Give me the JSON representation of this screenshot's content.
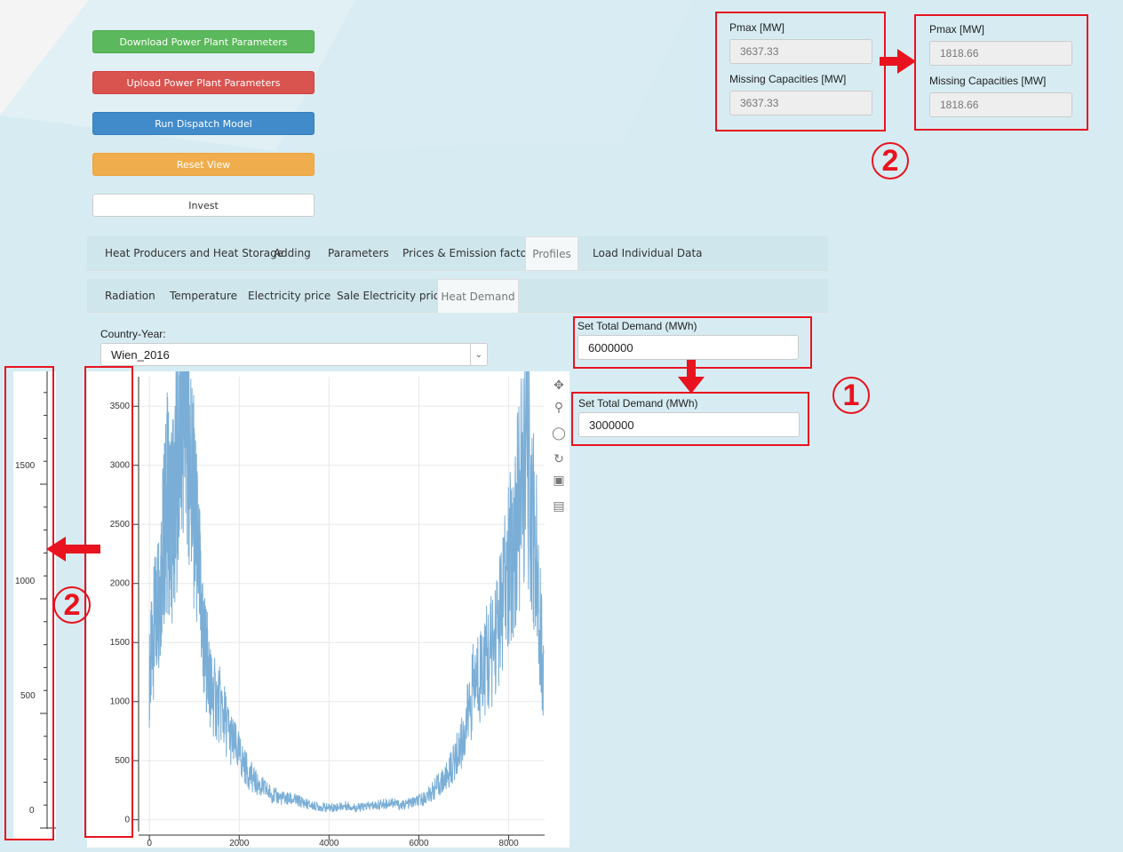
{
  "buttons": {
    "download": "Download Power Plant Parameters",
    "upload": "Upload Power Plant Parameters",
    "run": "Run Dispatch Model",
    "reset": "Reset View",
    "invest": "Invest"
  },
  "tabs_main": [
    "Heat Producers and Heat Storage",
    "Adding",
    "Parameters",
    "Prices & Emission factors",
    "Profiles",
    "Load Individual Data"
  ],
  "tabs_main_active": "Profiles",
  "tabs_sub": [
    "Radiation",
    "Temperature",
    "Electricity price",
    "Sale Electricity price",
    "Heat Demand"
  ],
  "tabs_sub_active": "Heat Demand",
  "country_year": {
    "label": "Country-Year:",
    "value": "Wien_2016"
  },
  "demand_before": {
    "label": "Set Total Demand (MWh)",
    "value": "6000000"
  },
  "demand_after": {
    "label": "Set Total Demand (MWh)",
    "value": "3000000"
  },
  "capacity_before": {
    "pmax_label": "Pmax [MW]",
    "pmax_value": "3637.33",
    "missing_label": "Missing Capacities [MW]",
    "missing_value": "3637.33"
  },
  "capacity_after": {
    "pmax_label": "Pmax [MW]",
    "pmax_value": "1818.66",
    "missing_label": "Missing Capacities [MW]",
    "missing_value": "1818.66"
  },
  "annotations": {
    "step1": "1",
    "step2_top": "2",
    "step2_left": "2"
  },
  "mini_axis": {
    "ticks": [
      "1500",
      "1000",
      "500",
      "0"
    ]
  },
  "chart_data": {
    "type": "line",
    "title": "",
    "xlabel": "",
    "ylabel": "",
    "xlim": [
      -200,
      8800
    ],
    "ylim": [
      -100,
      3750
    ],
    "xticks": [
      0,
      2000,
      4000,
      6000,
      8000
    ],
    "yticks": [
      0,
      500,
      1000,
      1500,
      2000,
      2500,
      3000,
      3500
    ],
    "grid": true,
    "color": "#7aaed6",
    "series": [
      {
        "x": [
          0,
          100,
          200,
          300,
          400,
          500,
          600,
          700,
          800,
          900,
          1000,
          1100,
          1200,
          1300,
          1400,
          1600,
          1800,
          2000,
          2200,
          2400,
          2600,
          2800,
          3000,
          3200,
          3400,
          3600,
          3800,
          4000,
          4200,
          4400,
          4600,
          4800,
          5000,
          5200,
          5400,
          5600,
          5800,
          6000,
          6200,
          6400,
          6600,
          6800,
          7000,
          7200,
          7400,
          7600,
          7800,
          8000,
          8200,
          8400,
          8600,
          8784
        ],
        "y": [
          1200,
          1600,
          1900,
          2300,
          2700,
          2500,
          2900,
          3300,
          3600,
          3200,
          2600,
          2100,
          1500,
          1300,
          1050,
          950,
          700,
          550,
          400,
          300,
          250,
          200,
          180,
          170,
          150,
          120,
          110,
          100,
          110,
          120,
          100,
          110,
          120,
          130,
          150,
          120,
          140,
          160,
          200,
          280,
          350,
          500,
          700,
          1100,
          1300,
          1400,
          1700,
          2100,
          2600,
          3100,
          2300,
          1200
        ]
      }
    ]
  }
}
